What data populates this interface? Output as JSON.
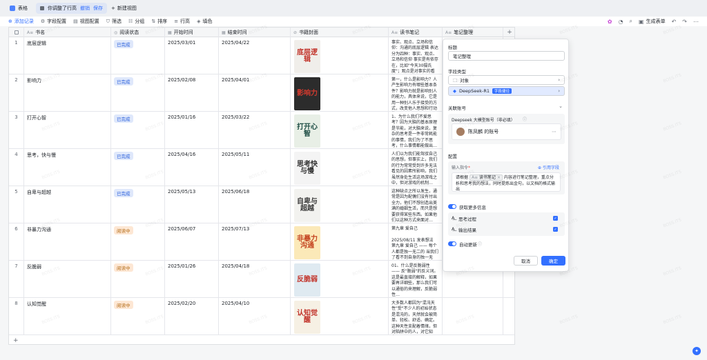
{
  "tabs": {
    "table_label": "表格",
    "view_label": "你调整了行高",
    "view_discard": "撤销",
    "view_save": "保存",
    "new_view": "新建视图"
  },
  "toolbar": {
    "add_record": "添加记录",
    "field_config": "字段配置",
    "view_config": "视图配置",
    "filter": "筛选",
    "group": "分组",
    "sort": "排序",
    "row_height": "行高",
    "fill_color": "填色",
    "generate_form": "生成表单"
  },
  "columns": [
    {
      "label": "书名",
      "icon": "text-icon"
    },
    {
      "label": "阅读状态",
      "icon": "status-icon"
    },
    {
      "label": "开始时间",
      "icon": "calendar-icon"
    },
    {
      "label": "结束时间",
      "icon": "calendar-icon"
    },
    {
      "label": "书籍封面",
      "icon": "attachment-icon"
    },
    {
      "label": "读书笔记",
      "icon": "text-icon"
    },
    {
      "label": "笔记整理",
      "icon": "text-icon"
    }
  ],
  "rows": [
    {
      "num": "1",
      "title": "底层逻辑",
      "status": "已完成",
      "status_type": "done",
      "start": "2025/03/01",
      "end": "2025/04/22",
      "note": "事实、观点、立场和信仰：沟通的底层逻辑 表达分为四种：事实、观点、立场和信仰 事实是有依存在，比如\"今天30摄氏度\"；观点是对事实的看法…",
      "cover_text": "底层逻辑",
      "cover_bg": "#f0eeea",
      "cover_fg": "#c2342b"
    },
    {
      "num": "2",
      "title": "影响力",
      "status": "已完成",
      "status_type": "done",
      "start": "2025/02/08",
      "end": "2025/04/01",
      "note": "第一，什么是影响力？人产生影响力有哪些基本条件？影响力就是影响别人的能力，具体来说，它是用一种别人乐于接受的方式，改变他人思想和行动的…",
      "cover_text": "影响力",
      "cover_bg": "#2c2c2c",
      "cover_fg": "#d13a2e"
    },
    {
      "num": "3",
      "title": "打开心智",
      "status": "已完成",
      "status_type": "done",
      "start": "2025/01/16",
      "end": "2025/03/22",
      "note": "1、为什么我们不爱思考？因为大脑的基本原理是节能，对大脑来说，复杂的思考是一件非常耗能的事情，我们为了不思考，什么事情都能做出…",
      "cover_text": "打开心智",
      "cover_bg": "#e8efe6",
      "cover_fg": "#1c4c43"
    },
    {
      "num": "4",
      "title": "思考，快与慢",
      "status": "已完成",
      "status_type": "done",
      "start": "2025/04/16",
      "end": "2025/05/11",
      "note": "人们以为我们能驾驭自己的思想，但事实上，我们的行为常常受到许多无法看见的因素所影响，我们虽然身处生活这场游戏之中，但对游戏的机制…",
      "cover_text": "思考快与慢",
      "cover_bg": "#f4f4f4",
      "cover_fg": "#333333"
    },
    {
      "num": "5",
      "title": "自卑与超越",
      "status": "已完成",
      "status_type": "done",
      "start": "2025/05/13",
      "end": "2025/06/18",
      "note": "这种缺点之所以发生，通常是因为配偶们没有付出全力，他们不想创造出美满的婚姻生活，而只是想要获得某些东西。如果他们以这种方式来面对…",
      "cover_text": "自卑与超越",
      "cover_bg": "#f2f2ef",
      "cover_fg": "#3a3a3a"
    },
    {
      "num": "6",
      "title": "非暴力沟通",
      "status": "阅读中",
      "status_type": "reading",
      "start": "2025/06/07",
      "end": "2025/07/13",
      "note": "第九章 爱自己\n\n2025/08/11 发表想法\n第九章 爱自己 —— 每个人都是独一无二的 当我们了看不到自身的独一无二…",
      "cover_text": "非暴力沟通",
      "cover_bg": "#fbe9b8",
      "cover_fg": "#c4431f"
    },
    {
      "num": "7",
      "title": "反脆弱",
      "status": "阅读中",
      "status_type": "reading",
      "start": "2025/01/26",
      "end": "2025/04/18",
      "note": "01、什么是反脆弱性 —— 反\"脆弱\"的反义词。这是最直接的解释，如果要再详细些，那么我们可以通俗的来理解，反脆弱性…",
      "cover_text": "反脆弱",
      "cover_bg": "#dfeaf1",
      "cover_fg": "#c2342b"
    },
    {
      "num": "8",
      "title": "认知觉醒",
      "status": "阅读中",
      "status_type": "reading",
      "start": "2025/02/20",
      "end": "2025/04/10",
      "note": "大多数人都因为\"混沌天性\"受\"不少人的初始状态是混沌的，天然就会被简单、轻松、舒适、确定。这种天性支配着情绪，但对陷阱中的人，对它知之…",
      "cover_text": "认知觉醒",
      "cover_bg": "#f6f0e4",
      "cover_fg": "#c2342b"
    }
  ],
  "panel": {
    "title_label": "标题",
    "title_value": "笔记整理",
    "field_type_label": "字段类型",
    "field_type_value": "对象",
    "model_value": "DeepSeek-R1",
    "model_badge": "字段捷径",
    "account_label": "关联账号",
    "account_box_title": "Deepseek 大模型账号（非必填）",
    "account_name": "陈凤麟 的账号",
    "config_label": "配置",
    "instruction_label": "输入指令",
    "instruction_required": "*",
    "ref_field": "引用字段",
    "instruction_prefix": "请根据",
    "instruction_chip": "读书笔记",
    "instruction_body": "内容进行笔记整理，重点分析和思考我的想法，同时提炼出金句，以文档的格式输出",
    "more_info_label": "获取更多信息",
    "thinking_label": "思考过程",
    "output_label": "输出结果",
    "auto_update_label": "自动更新",
    "cancel": "取消",
    "confirm": "确定"
  },
  "watermark": "BOSS.ITS"
}
